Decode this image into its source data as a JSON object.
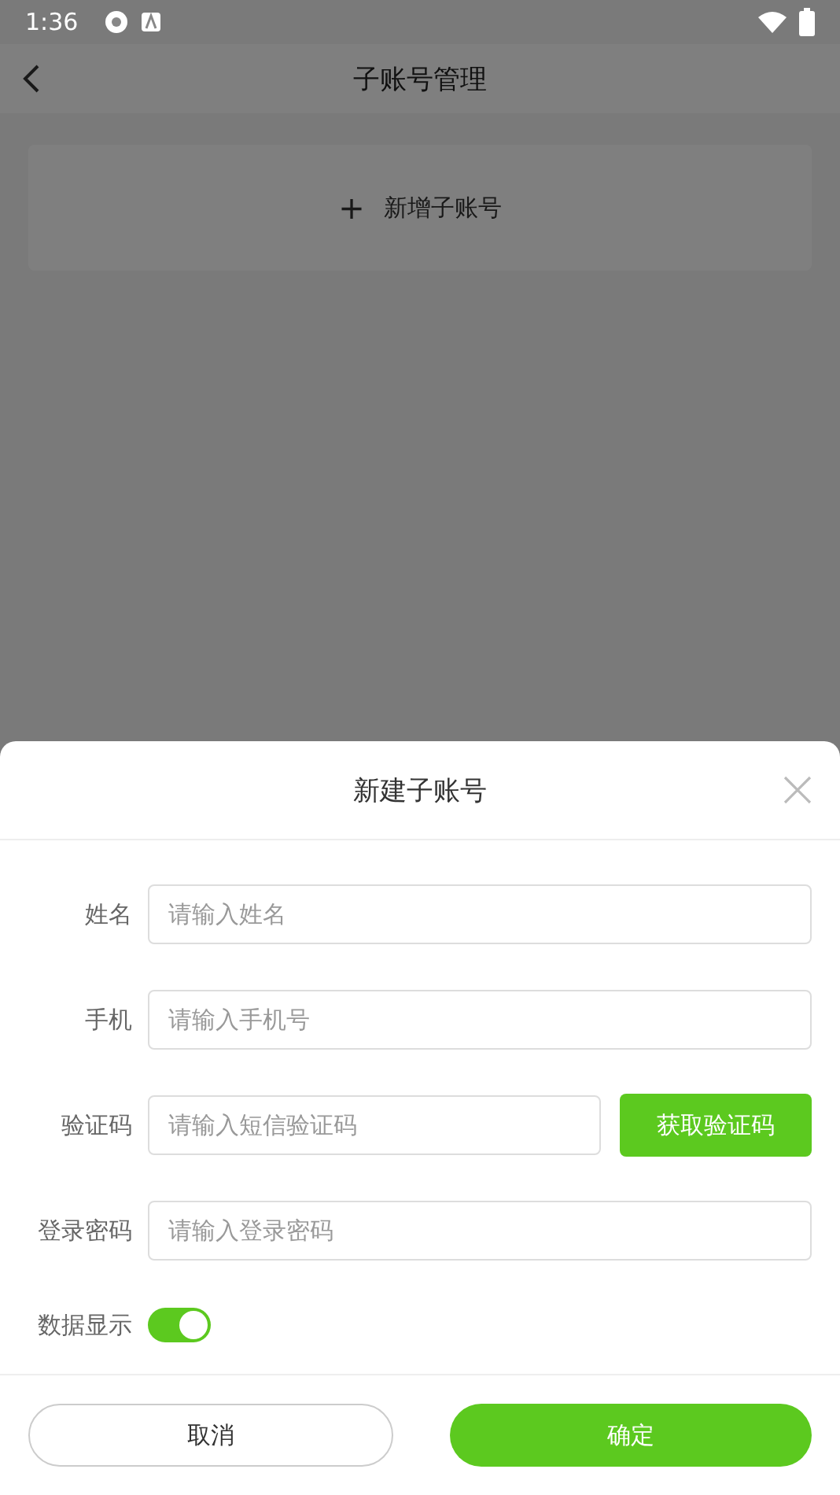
{
  "status_bar": {
    "time": "1:36"
  },
  "header": {
    "title": "子账号管理"
  },
  "add_button": {
    "icon": "+",
    "label": "新增子账号"
  },
  "dialog": {
    "title": "新建子账号",
    "fields": [
      {
        "kind": "text",
        "label": "姓名",
        "placeholder": "请输入姓名"
      },
      {
        "kind": "text",
        "label": "手机",
        "placeholder": "请输入手机号"
      },
      {
        "kind": "code",
        "label": "验证码",
        "placeholder": "请输入短信验证码",
        "button": "获取验证码"
      },
      {
        "kind": "text",
        "label": "登录密码",
        "placeholder": "请输入登录密码"
      }
    ],
    "toggle": {
      "label": "数据显示",
      "on": true
    },
    "buttons": [
      {
        "kind": "secondary",
        "label": "取消"
      },
      {
        "kind": "primary",
        "label": "确定"
      }
    ]
  }
}
